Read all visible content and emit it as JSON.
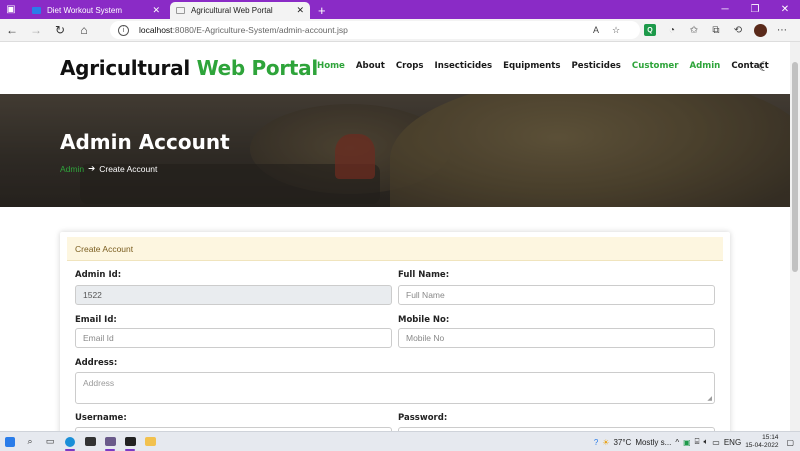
{
  "browser": {
    "tabs": [
      {
        "title": "Diet Workout System",
        "active": false,
        "favicon_color": "#2b7de9"
      },
      {
        "title": "Agricultural Web Portal",
        "active": true,
        "favicon_color": "#ffffff"
      }
    ],
    "url_host": "localhost",
    "url_path": ":8080/E-Agriculture-System/admin-account.jsp"
  },
  "site": {
    "brand_part1": "Agricultural",
    "brand_part2": "Web Portal",
    "brand_accent": "#2ea43a",
    "menu": [
      {
        "label": "Home",
        "highlight": true
      },
      {
        "label": "About",
        "highlight": false
      },
      {
        "label": "Crops",
        "highlight": false
      },
      {
        "label": "Insecticides",
        "highlight": false
      },
      {
        "label": "Equipments",
        "highlight": false
      },
      {
        "label": "Pesticides",
        "highlight": false
      },
      {
        "label": "Customer",
        "highlight": true
      },
      {
        "label": "Admin",
        "highlight": true
      },
      {
        "label": "Contact",
        "highlight": false
      }
    ]
  },
  "hero": {
    "title": "Admin Account",
    "breadcrumb_link": "Admin",
    "breadcrumb_current": "Create Account"
  },
  "form": {
    "header": "Create Account",
    "admin_id_label": "Admin Id:",
    "admin_id_value": "1522",
    "full_name_label": "Full Name:",
    "full_name_placeholder": "Full Name",
    "email_label": "Email Id:",
    "email_placeholder": "Email Id",
    "mobile_label": "Mobile No:",
    "mobile_placeholder": "Mobile No",
    "address_label": "Address:",
    "address_placeholder": "Address",
    "username_label": "Username:",
    "password_label": "Password:"
  },
  "taskbar": {
    "weather": "37°C",
    "weather_text": "Mostly s...",
    "lang": "ENG",
    "time": "15:14",
    "date": "15-04-2022"
  }
}
